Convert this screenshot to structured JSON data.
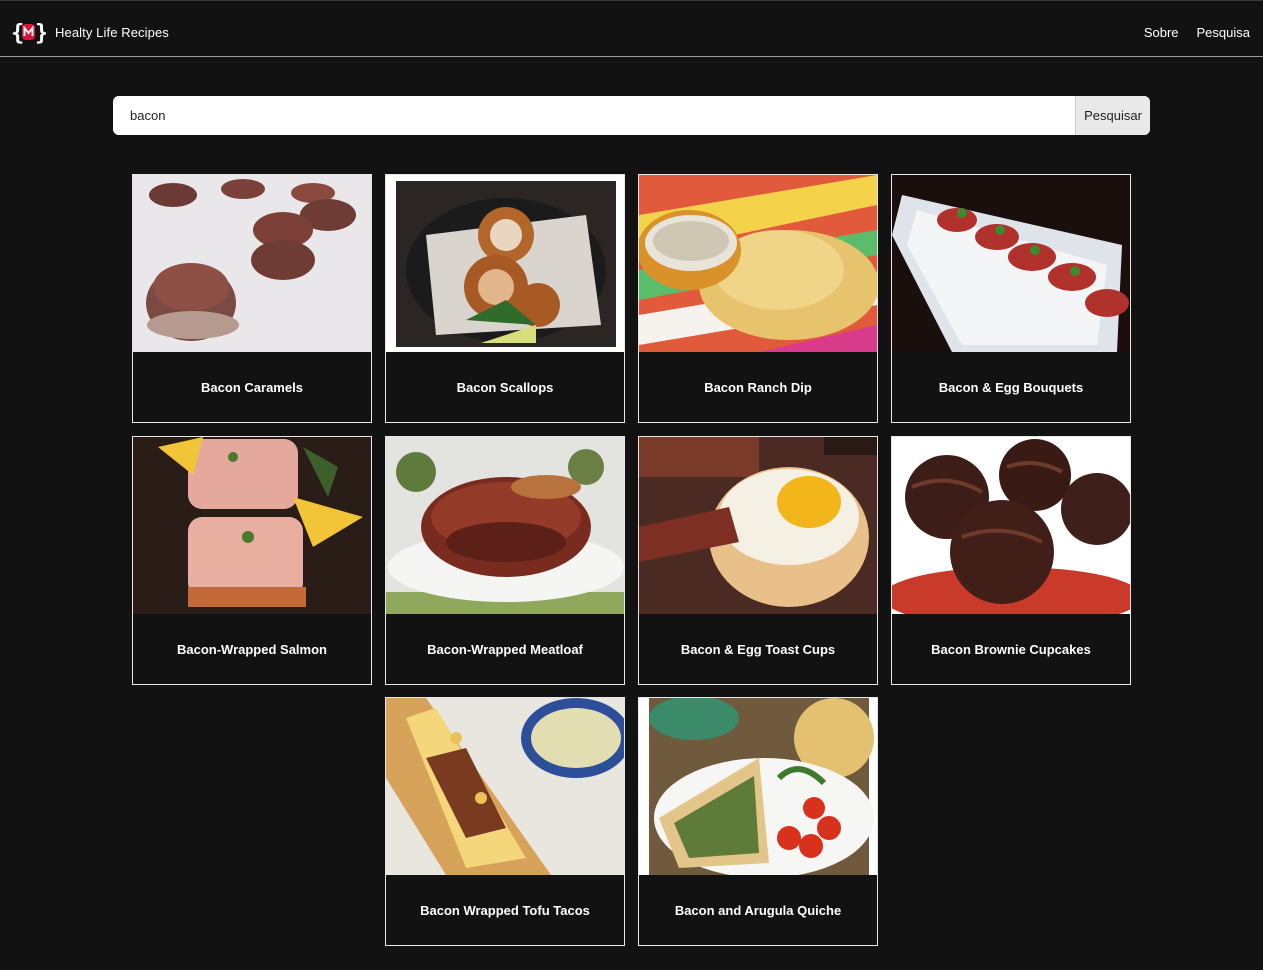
{
  "app": {
    "title": "Healty Life Recipes",
    "logo_icon": "code-braces-logo-icon",
    "accent": "#d7163a"
  },
  "nav": {
    "links": [
      {
        "label": "Sobre"
      },
      {
        "label": "Pesquisa"
      }
    ]
  },
  "search": {
    "value": "bacon",
    "button_label": "Pesquisar"
  },
  "recipes": [
    {
      "title": "Bacon Caramels"
    },
    {
      "title": "Bacon Scallops"
    },
    {
      "title": "Bacon Ranch Dip"
    },
    {
      "title": "Bacon & Egg Bouquets"
    },
    {
      "title": "Bacon-Wrapped Salmon"
    },
    {
      "title": "Bacon-Wrapped Meatloaf"
    },
    {
      "title": "Bacon & Egg Toast Cups"
    },
    {
      "title": "Bacon Brownie Cupcakes"
    },
    {
      "title": "Bacon Wrapped Tofu Tacos"
    },
    {
      "title": "Bacon and Arugula Quiche"
    }
  ]
}
